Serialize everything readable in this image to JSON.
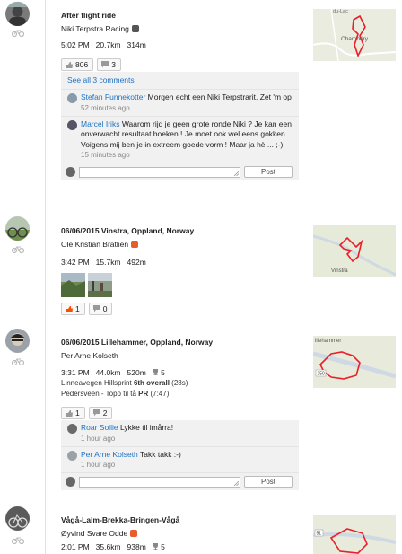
{
  "entries": [
    {
      "title": "After flight ride",
      "athlete": "Niki Terpstra Racing",
      "time": "5:02 PM",
      "distance": "20.7km",
      "elevation": "314m",
      "kudos_count": "806",
      "comment_count": "3",
      "see_all": "See all 3 comments",
      "map_labels": [
        "du-Lac",
        "Chambéry"
      ],
      "comments": [
        {
          "author": "Stefan Funnekotter",
          "text": "Morgen echt een Niki Terpstrarit. Zet 'm op",
          "time": "52 minutes ago"
        },
        {
          "author": "Marcel Iriks",
          "text": "Waarom rijd je geen grote ronde Niki ? Je kan een onverwacht resultaat boeken ! Je moet ook wel eens gokken . Voigens mij ben je in extreem goede vorm ! Maar ja hè ... ;-)",
          "time": "15 minutes ago"
        }
      ],
      "post_label": "Post"
    },
    {
      "title": "06/06/2015 Vinstra, Oppland, Norway",
      "athlete": "Ole Kristian Bratlien",
      "time": "3:42 PM",
      "distance": "15.7km",
      "elevation": "492m",
      "kudos_count": "1",
      "comment_count": "0",
      "map_labels": [
        "Vinstra"
      ]
    },
    {
      "title": "06/06/2015 Lillehammer, Oppland, Norway",
      "athlete": "Per Arne Kolseth",
      "time": "3:31 PM",
      "distance": "44.0km",
      "elevation": "520m",
      "achievements": "5",
      "achv_line1_pre": "Linneavegen Hillsprint ",
      "achv_line1_bold": "6th overall",
      "achv_line1_post": " (28s)",
      "achv_line2_pre": "Pedersveen - Topp til tå ",
      "achv_line2_bold": "PR",
      "achv_line2_post": " (7:47)",
      "kudos_count": "1",
      "comment_count": "2",
      "map_labels": [
        "illehammer",
        "250"
      ],
      "comments": [
        {
          "author": "Roar Sollie",
          "text": "Lykke til imårra!",
          "time": "1 hour ago"
        },
        {
          "author": "Per Arne Kolseth",
          "text": "Takk takk :-)",
          "time": "1 hour ago"
        }
      ],
      "post_label": "Post"
    },
    {
      "title": "Vågå-Lalm-Brekka-Bringen-Vågå",
      "athlete": "Øyvind Svare Odde",
      "time": "2:01 PM",
      "distance": "35.6km",
      "elevation": "938m",
      "achievements": "5",
      "map_labels": [
        "51"
      ]
    }
  ],
  "colors": {
    "link": "#1f73c4",
    "kudos": "#fc4c02",
    "route": "#e8202a",
    "badge": "#e85b2b"
  },
  "icons": [
    "bike-icon",
    "thumbs-up-icon",
    "comment-icon",
    "trophy-icon",
    "badge-icon",
    "resize-handle-icon"
  ]
}
